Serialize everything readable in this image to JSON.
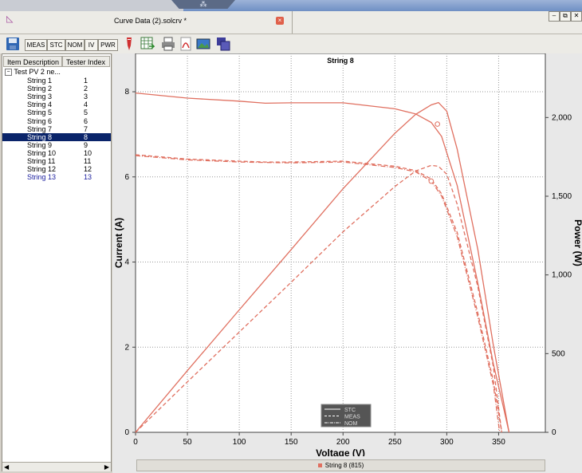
{
  "window": {
    "document_tab": "Curve Data (2).solcrv *",
    "close_tab_glyph": "×",
    "controls": [
      "–",
      "⧉",
      "✕"
    ]
  },
  "toolbar": {
    "mode_buttons": [
      "MEAS",
      "STC",
      "NOM",
      "IV",
      "PWR"
    ],
    "icons": [
      "save-icon",
      "ruler-icon",
      "spreadsheet-export-icon",
      "print-icon",
      "pdf-icon",
      "image-export-icon",
      "windows-icon"
    ]
  },
  "tree": {
    "columns": [
      "Item Description",
      "Tester Index"
    ],
    "root_label": "Test PV 2 ne...",
    "items": [
      {
        "name": "String 1",
        "index": "1"
      },
      {
        "name": "String 2",
        "index": "2"
      },
      {
        "name": "String 3",
        "index": "3"
      },
      {
        "name": "String 4",
        "index": "4"
      },
      {
        "name": "String 5",
        "index": "5"
      },
      {
        "name": "String 6",
        "index": "6"
      },
      {
        "name": "String 7",
        "index": "7"
      },
      {
        "name": "String 8",
        "index": "8"
      },
      {
        "name": "String 9",
        "index": "9"
      },
      {
        "name": "String 10",
        "index": "10"
      },
      {
        "name": "String 11",
        "index": "11"
      },
      {
        "name": "String 12",
        "index": "12"
      },
      {
        "name": "String 13",
        "index": "13"
      }
    ],
    "selected_index": 7
  },
  "chart_data": {
    "type": "line",
    "title": "String 8",
    "xlabel": "Voltage (V)",
    "ylabel": "Current (A)",
    "y2label": "Power (W)",
    "xlim": [
      0,
      395
    ],
    "ylim": [
      0,
      8.9
    ],
    "y2lim": [
      0,
      2407
    ],
    "x_ticks": [
      "0",
      "50",
      "100",
      "150",
      "200",
      "250",
      "300",
      "350"
    ],
    "y_ticks": [
      "0",
      "2",
      "4",
      "6",
      "8"
    ],
    "y2_ticks": [
      "0",
      "500",
      "1,000",
      "1,500",
      "2,000"
    ],
    "grid": true,
    "curve_color": "#e07060",
    "legend": [
      "STC",
      "MEAS",
      "NOM"
    ],
    "legend_placement": "bottom-center",
    "series": [
      {
        "name": "STC",
        "axis": "current",
        "x": [
          0,
          50,
          100,
          125,
          150,
          200,
          250,
          270,
          285,
          295,
          310,
          330,
          345,
          355,
          360
        ],
        "y": [
          7.97,
          7.85,
          7.78,
          7.73,
          7.74,
          7.74,
          7.6,
          7.48,
          7.28,
          6.95,
          5.8,
          3.5,
          1.6,
          0.55,
          0
        ]
      },
      {
        "name": "STC",
        "axis": "power",
        "x": [
          0,
          50,
          100,
          150,
          200,
          250,
          270,
          285,
          292,
          300,
          310,
          330,
          345,
          360
        ],
        "y": [
          0,
          392,
          778,
          1161,
          1548,
          1900,
          2020,
          2080,
          2095,
          2040,
          1800,
          1160,
          550,
          0
        ]
      },
      {
        "name": "MEAS",
        "axis": "current",
        "x": [
          0,
          50,
          100,
          125,
          150,
          200,
          250,
          270,
          285,
          295,
          310,
          330,
          345,
          353
        ],
        "y": [
          6.52,
          6.42,
          6.37,
          6.35,
          6.35,
          6.37,
          6.25,
          6.15,
          5.95,
          5.6,
          4.7,
          2.8,
          1.2,
          0
        ]
      },
      {
        "name": "MEAS",
        "axis": "power",
        "x": [
          0,
          50,
          100,
          150,
          200,
          250,
          270,
          285,
          292,
          300,
          310,
          330,
          345,
          353
        ],
        "y": [
          0,
          321,
          637,
          953,
          1274,
          1562,
          1660,
          1696,
          1690,
          1640,
          1450,
          924,
          414,
          0
        ]
      },
      {
        "name": "NOM",
        "axis": "current",
        "x": [
          0,
          50,
          100,
          150,
          200,
          250,
          270,
          285,
          295,
          310,
          330,
          345,
          351
        ],
        "y": [
          6.5,
          6.4,
          6.35,
          6.33,
          6.35,
          6.22,
          6.12,
          5.9,
          5.55,
          4.6,
          2.7,
          1.1,
          0
        ]
      }
    ],
    "markers": [
      {
        "x": 291,
        "y": 7.24,
        "axis": "current"
      },
      {
        "x": 285,
        "y": 5.9,
        "axis": "current"
      }
    ],
    "status": "String 8 (815)"
  }
}
